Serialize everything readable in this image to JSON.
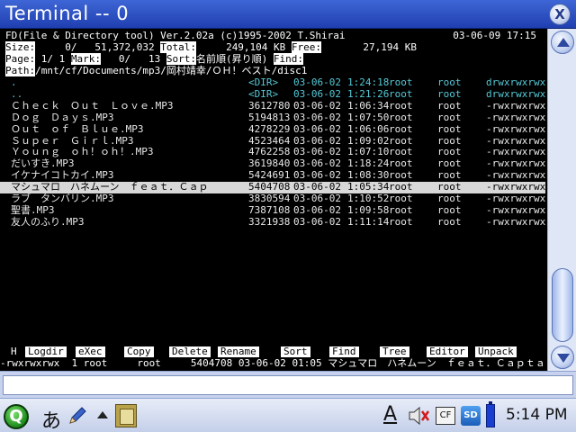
{
  "window": {
    "title": "Terminal -- 0",
    "close": "X"
  },
  "fd": {
    "header": "FD(File & Directory tool) Ver.2.02a (c)1995-2002 T.Shirai",
    "date": "03-06-09 17:15",
    "status1": {
      "size_label": "Size:",
      "size_value": "     0/   51,372,032 ",
      "total_label": "Total:",
      "total_value": "     249,104 KB ",
      "free_label": "Free:",
      "free_value": "       27,194 KB"
    },
    "status2": {
      "page_label": "Page:",
      "page_value": " 1/ 1 ",
      "mark_label": "Mark:",
      "mark_value": "   0/   13 ",
      "sort_label": "Sort:",
      "sort_value": "名前順(昇り順) ",
      "find_label": "Find:",
      "find_value": ""
    },
    "path_label": "Path:",
    "path_value": "/mnt/cf/Documents/mp3/岡村靖幸/ＯＨ！ベスト/disc1",
    "files": [
      {
        "name": ".",
        "size": "<DIR>",
        "date": "03-06-02",
        "time": "1:24:18",
        "user": "root",
        "group": "root",
        "perm": "drwxrwxrwx",
        "kind": "dir"
      },
      {
        "name": "..",
        "size": "<DIR>",
        "date": "03-06-02",
        "time": "1:21:26",
        "user": "root",
        "group": "root",
        "perm": "drwxrwxrwx",
        "kind": "dir"
      },
      {
        "name": "Ｃｈｅｃｋ　Ｏｕｔ　Ｌｏｖｅ.MP3",
        "size": "3612780",
        "date": "03-06-02",
        "time": "1:06:34",
        "user": "root",
        "group": "root",
        "perm": "-rwxrwxrwx",
        "kind": "file"
      },
      {
        "name": "Ｄｏｇ　Ｄａｙｓ.MP3",
        "size": "5194813",
        "date": "03-06-02",
        "time": "1:07:50",
        "user": "root",
        "group": "root",
        "perm": "-rwxrwxrwx",
        "kind": "file"
      },
      {
        "name": "Ｏｕｔ　ｏｆ　Ｂｌｕｅ.MP3",
        "size": "4278229",
        "date": "03-06-02",
        "time": "1:06:06",
        "user": "root",
        "group": "root",
        "perm": "-rwxrwxrwx",
        "kind": "file"
      },
      {
        "name": "Ｓｕｐｅｒ　Ｇｉｒｌ.MP3",
        "size": "4523464",
        "date": "03-06-02",
        "time": "1:09:02",
        "user": "root",
        "group": "root",
        "perm": "-rwxrwxrwx",
        "kind": "file"
      },
      {
        "name": "Ｙｏｕｎｇ　ｏｈ！ｏｈ！.MP3",
        "size": "4762258",
        "date": "03-06-02",
        "time": "1:07:10",
        "user": "root",
        "group": "root",
        "perm": "-rwxrwxrwx",
        "kind": "file"
      },
      {
        "name": "だいすき.MP3",
        "size": "3619840",
        "date": "03-06-02",
        "time": "1:18:24",
        "user": "root",
        "group": "root",
        "perm": "-rwxrwxrwx",
        "kind": "file"
      },
      {
        "name": "イケナイコトカイ.MP3",
        "size": "5424691",
        "date": "03-06-02",
        "time": "1:08:30",
        "user": "root",
        "group": "root",
        "perm": "-rwxrwxrwx",
        "kind": "file"
      },
      {
        "name": "マシュマロ　ハネムーン　ｆｅａｔ．Ｃａｐ",
        "size": "5404708",
        "date": "03-06-02",
        "time": "1:05:34",
        "user": "root",
        "group": "root",
        "perm": "-rwxrwxrwx",
        "kind": "selected"
      },
      {
        "name": "ラブ　タンバリン.MP3",
        "size": "3830594",
        "date": "03-06-02",
        "time": "1:10:52",
        "user": "root",
        "group": "root",
        "perm": "-rwxrwxrwx",
        "kind": "file"
      },
      {
        "name": "聖書.MP3",
        "size": "7387108",
        "date": "03-06-02",
        "time": "1:09:58",
        "user": "root",
        "group": "root",
        "perm": "-rwxrwxrwx",
        "kind": "file"
      },
      {
        "name": "友人のふり.MP3",
        "size": "3321938",
        "date": "03-06-02",
        "time": "1:11:14",
        "user": "root",
        "group": "root",
        "perm": "-rwxrwxrwx",
        "kind": "file"
      }
    ],
    "fkey_prefix": "H",
    "fkeys": [
      "Logdir",
      "eXec",
      "Copy",
      "Delete",
      "Rename",
      "Sort",
      "Find",
      "Tree",
      "Editor",
      "Unpack"
    ],
    "info_line": "-rwxrwxrwx  1 root     root     5404708 03-06-02 01:05 マシュマロ　ハネムーン　ｆｅａｔ．Ｃａｐｔａ"
  },
  "taskbar": {
    "q_logo": "Q",
    "ime_label": "あ",
    "kbd_label": "A",
    "cf_label": "CF",
    "sd_label": "SD",
    "clock": "5:14 PM"
  },
  "icons": {
    "close": "close-icon",
    "scroll_up": "scroll-up-icon",
    "scroll_down": "scroll-down-icon",
    "pencil": "pencil-icon",
    "terminal": "terminal-icon",
    "volume_muted": "volume-muted-icon",
    "battery": "battery-icon"
  }
}
